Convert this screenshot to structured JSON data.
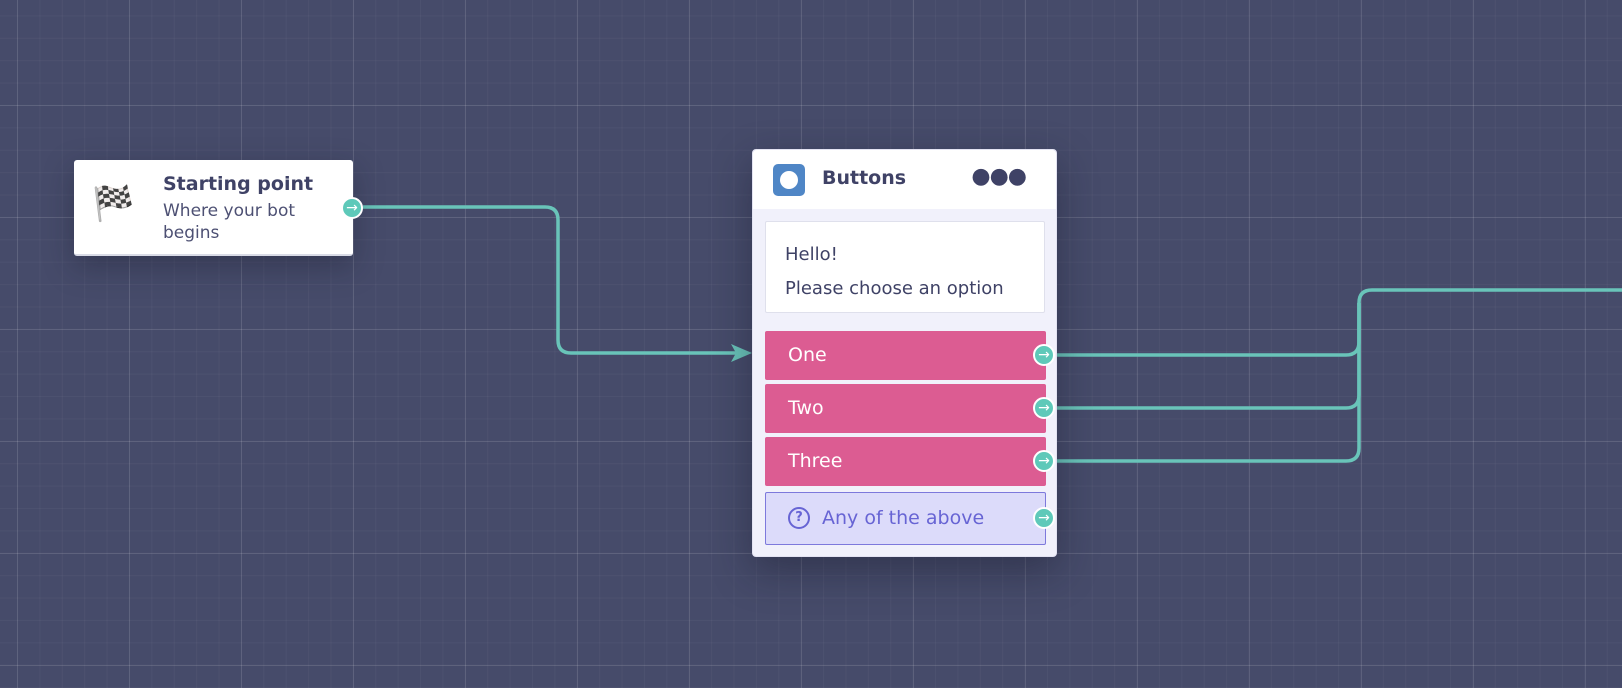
{
  "canvas": {
    "background_color": "#464b6a",
    "connector_color": "#69c4b9"
  },
  "start_node": {
    "icon": "checkered-flag-icon",
    "title": "Starting point",
    "subtitle": "Where your bot begins"
  },
  "buttons_node": {
    "icon": "buttons-block-icon",
    "title": "Buttons",
    "more_icon": "more-horizontal-icon",
    "message_lines": [
      "Hello!",
      "Please choose an option"
    ],
    "options": [
      {
        "label": "One",
        "color": "#dc5c92"
      },
      {
        "label": "Two",
        "color": "#dc5c92"
      },
      {
        "label": "Three",
        "color": "#dc5c92"
      }
    ],
    "fallback": {
      "label": "Any of the above",
      "icon": "question-circle-icon",
      "color": "#dcdbfa"
    }
  },
  "port_icon": "arrow-right-icon"
}
